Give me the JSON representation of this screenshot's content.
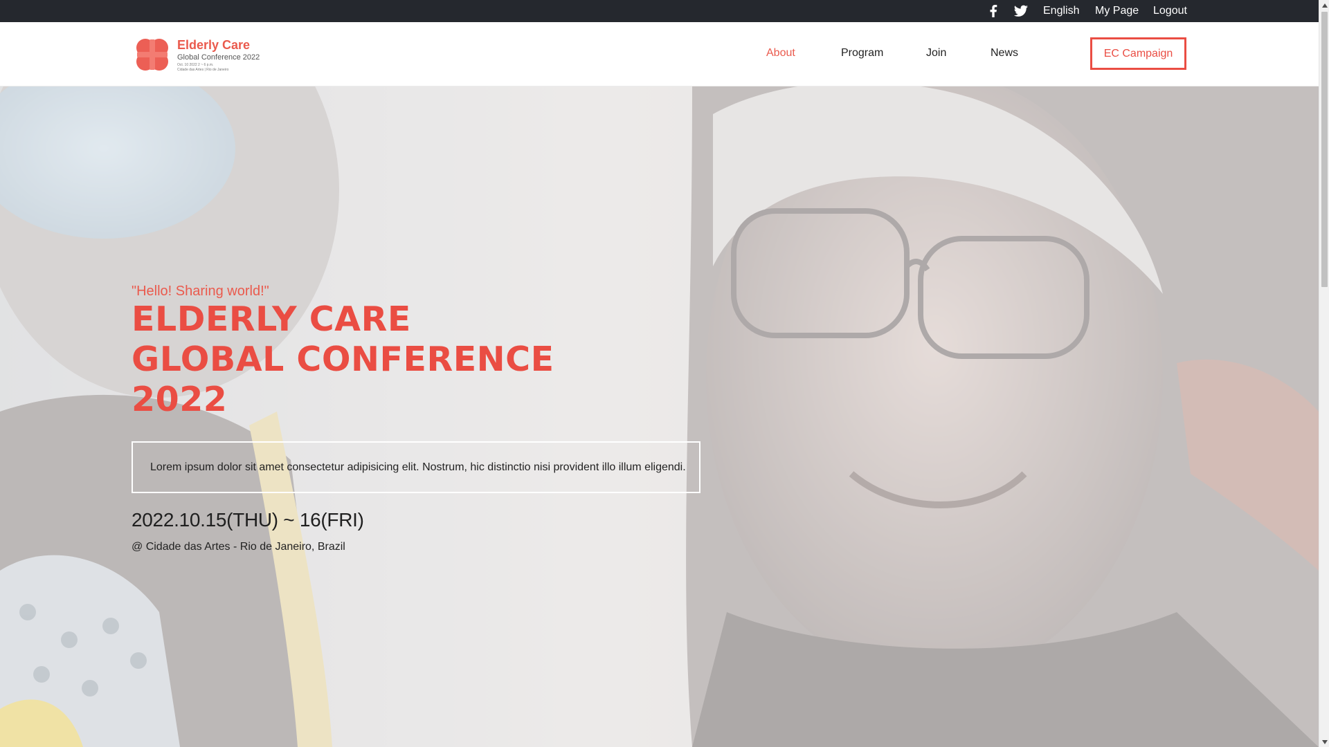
{
  "topbar": {
    "facebook_icon": "facebook-icon",
    "twitter_icon": "twitter-icon",
    "language": "English",
    "my_page": "My Page",
    "logout": "Logout"
  },
  "header": {
    "logo": {
      "brand": "Elderly Care",
      "subtitle": "Global Conference 2022",
      "tiny_line1": "Oct. 10 2022  2 ~ 6 p.m.",
      "tiny_line2": "Cidade das Artes | Rio de Janeiro"
    },
    "nav": {
      "about": "About",
      "program": "Program",
      "join": "Join",
      "news": "News"
    },
    "campaign_button": "EC Campaign"
  },
  "hero": {
    "tagline": "\"Hello! Sharing world!\"",
    "title_lines": [
      "ELDERLY CARE",
      "GLOBAL CONFERENCE",
      "2022"
    ],
    "description": "Lorem ipsum dolor sit amet consectetur adipisicing elit. Nostrum, hic distinctio nisi provident illo illum eligendi.",
    "date": "2022.10.15(THU) ~ 16(FRI)",
    "venue": "@ Cidade das Artes - Rio de Janeiro, Brazil"
  },
  "colors": {
    "accent": "#ea4d43",
    "topbar_bg": "#25282e",
    "text": "#222222"
  }
}
